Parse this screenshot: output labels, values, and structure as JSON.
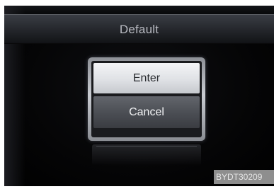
{
  "screen": {
    "title": "Default"
  },
  "dialog": {
    "enter_label": "Enter",
    "cancel_label": "Cancel"
  },
  "watermark": {
    "code": "BYDT30209"
  },
  "colors": {
    "screen_bg": "#050506",
    "title_text": "#b9bbc2",
    "enter_bg": "#e6e8eb",
    "cancel_bg": "#4a4d53"
  }
}
